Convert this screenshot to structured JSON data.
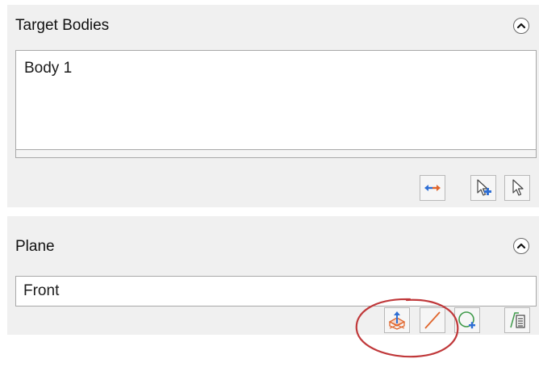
{
  "target_bodies": {
    "title": "Target Bodies",
    "collapse_icon": "chevron-up-icon",
    "items": [
      "Body 1"
    ],
    "tools": [
      {
        "name": "swap-direction-icon"
      },
      {
        "name": "add-selection-icon"
      },
      {
        "name": "select-pointer-icon"
      }
    ]
  },
  "plane": {
    "title": "Plane",
    "collapse_icon": "chevron-up-icon",
    "value": "Front",
    "tools": [
      {
        "name": "plane-from-face-icon",
        "highlighted": true
      },
      {
        "name": "line-plane-icon"
      },
      {
        "name": "circle-plane-icon"
      },
      {
        "name": "plane-list-icon"
      }
    ]
  },
  "colors": {
    "panel_background": "#f0f0f0",
    "highlight_ring": "#c0383a",
    "accent_blue": "#2f6fd4",
    "accent_orange": "#e0662d"
  }
}
